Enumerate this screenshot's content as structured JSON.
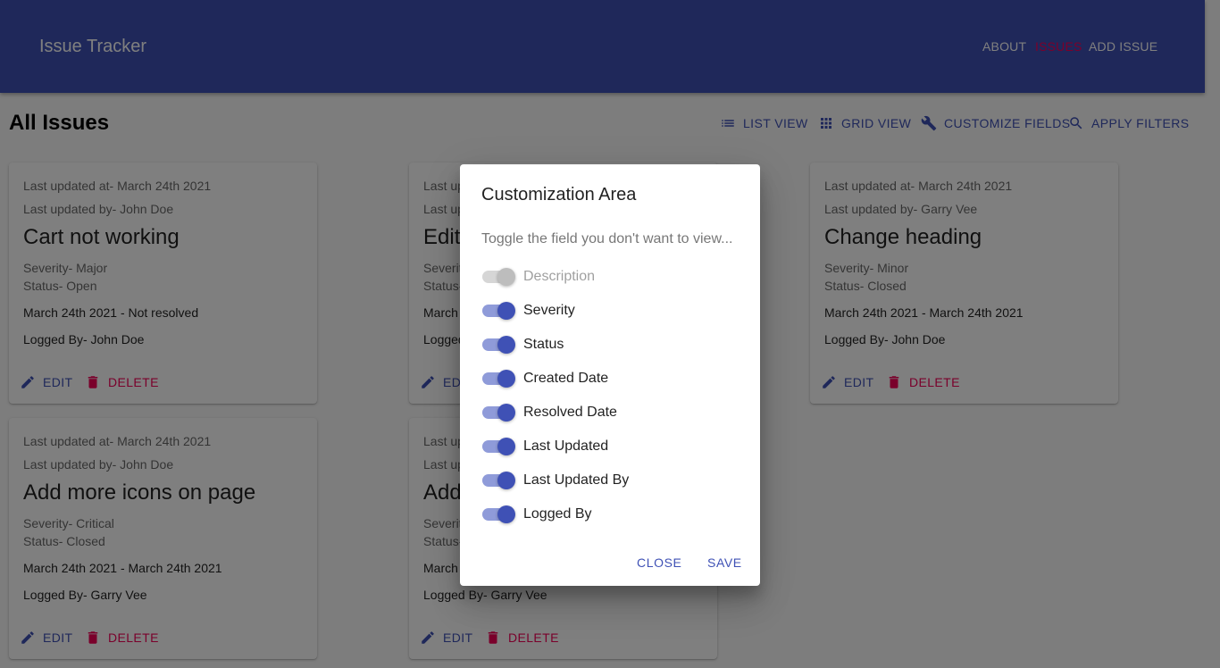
{
  "header": {
    "title": "Issue Tracker",
    "nav": {
      "about": "ABOUT",
      "issues": "ISSUES",
      "add_issue": "ADD ISSUE"
    }
  },
  "toolbar": {
    "page_title": "All Issues",
    "list_view": "LIST VIEW",
    "grid_view": "GRID VIEW",
    "customize_fields": "CUSTOMIZE FIELDS",
    "apply_filters": "APPLY FILTERS"
  },
  "cards": [
    {
      "last_updated_at": "Last updated at- March 24th 2021",
      "last_updated_by": "Last updated by- John Doe",
      "title": "Cart not working",
      "severity": "Severity- Major",
      "status": "Status- Open",
      "dates": "March 24th 2021 - Not resolved",
      "logged_by": "Logged By- John Doe"
    },
    {
      "last_updated_at": "Last updated at- March 24th 2021",
      "last_updated_by": "Last updated by- John Doe",
      "title": "Edit",
      "severity": "Severity- Minor",
      "status": "Status- Open",
      "dates": "March 24th 2021 - Not resolved",
      "logged_by": "Logged By- John Doe"
    },
    {
      "last_updated_at": "Last updated at- March 24th 2021",
      "last_updated_by": "Last updated by- Garry Vee",
      "title": "Change heading",
      "severity": "Severity- Minor",
      "status": "Status- Closed",
      "dates": "March 24th 2021 - March 24th 2021",
      "logged_by": "Logged By- John Doe"
    },
    {
      "last_updated_at": "Last updated at- March 24th 2021",
      "last_updated_by": "Last updated by- John Doe",
      "title": "Add more icons on page",
      "severity": "Severity- Critical",
      "status": "Status- Closed",
      "dates": "March 24th 2021 - March 24th 2021",
      "logged_by": "Logged By- Garry Vee"
    },
    {
      "last_updated_at": "Last updated at- March 24th 2021",
      "last_updated_by": "Last updated by- John Doe",
      "title": "Add",
      "severity": "Severity- Critical",
      "status": "Status- Closed",
      "dates": "March 24th 2021 - March 24th 2021",
      "logged_by": "Logged By- Garry Vee"
    }
  ],
  "card_actions": {
    "edit": "EDIT",
    "delete": "DELETE"
  },
  "dialog": {
    "title": "Customization Area",
    "description": "Toggle the field you don't want to view...",
    "fields": [
      {
        "label": "Description",
        "checked": true,
        "disabled": true
      },
      {
        "label": "Severity",
        "checked": true,
        "disabled": false
      },
      {
        "label": "Status",
        "checked": true,
        "disabled": false
      },
      {
        "label": "Created Date",
        "checked": true,
        "disabled": false
      },
      {
        "label": "Resolved Date",
        "checked": true,
        "disabled": false
      },
      {
        "label": "Last Updated",
        "checked": true,
        "disabled": false
      },
      {
        "label": "Last Updated By",
        "checked": true,
        "disabled": false
      },
      {
        "label": "Logged By",
        "checked": true,
        "disabled": false
      }
    ],
    "close": "CLOSE",
    "save": "SAVE"
  },
  "colors": {
    "primary": "#3f51b5",
    "secondary": "#f50057"
  }
}
